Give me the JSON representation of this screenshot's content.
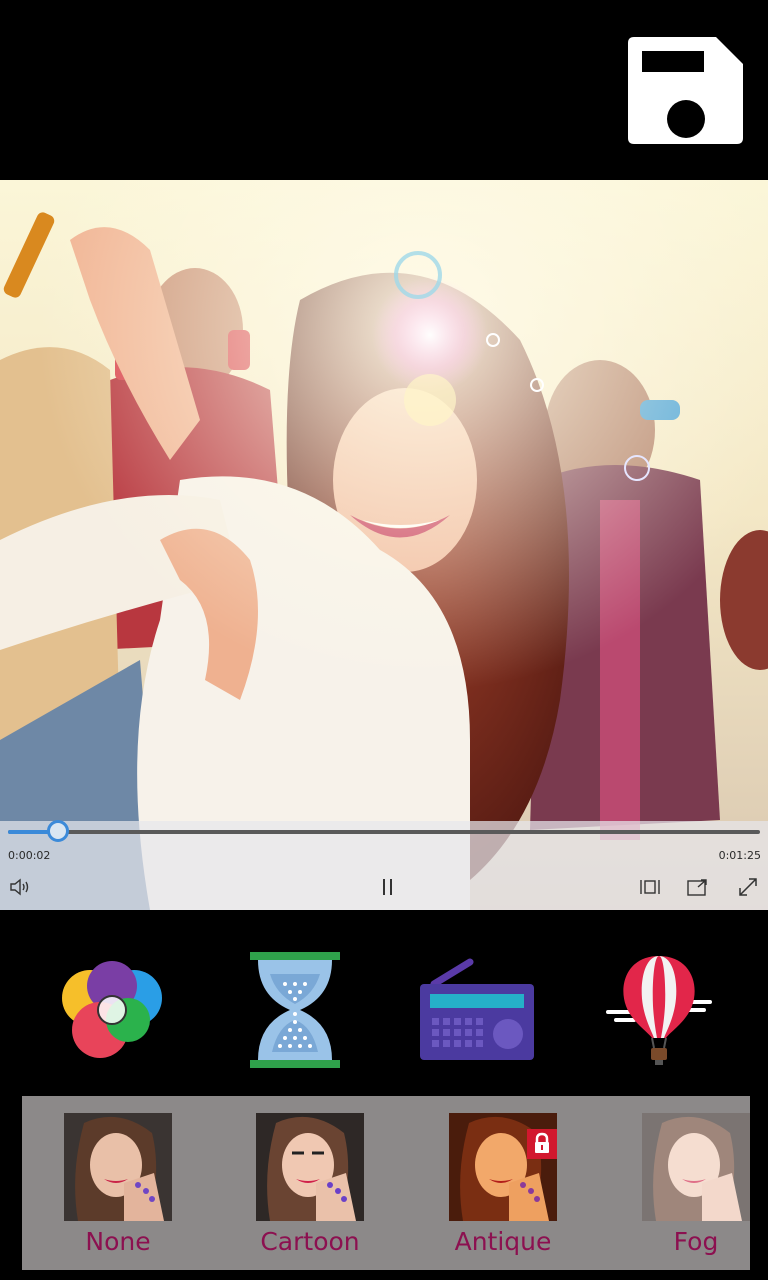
{
  "app": {
    "save_icon": "save-floppy-icon"
  },
  "player": {
    "elapsed": "0:00:02",
    "total": "0:01:25",
    "progress_fraction": 0.066,
    "icons": {
      "volume": "volume-icon",
      "pause": "pause-icon",
      "aspect": "aspect-ratio-icon",
      "cast": "cast-icon",
      "fullscreen": "fullscreen-icon"
    }
  },
  "tools": [
    {
      "name": "color-adjust-icon"
    },
    {
      "name": "hourglass-icon"
    },
    {
      "name": "radio-music-icon"
    },
    {
      "name": "hot-air-balloon-icon"
    }
  ],
  "filters": [
    {
      "label": "None",
      "locked": false
    },
    {
      "label": "Cartoon",
      "locked": false
    },
    {
      "label": "Antique",
      "locked": true
    },
    {
      "label": "Fog",
      "locked": false
    }
  ],
  "colors": {
    "accent": "#3b8ad9",
    "filter_label": "#8c1050",
    "filter_strip_bg": "#8c8989"
  }
}
